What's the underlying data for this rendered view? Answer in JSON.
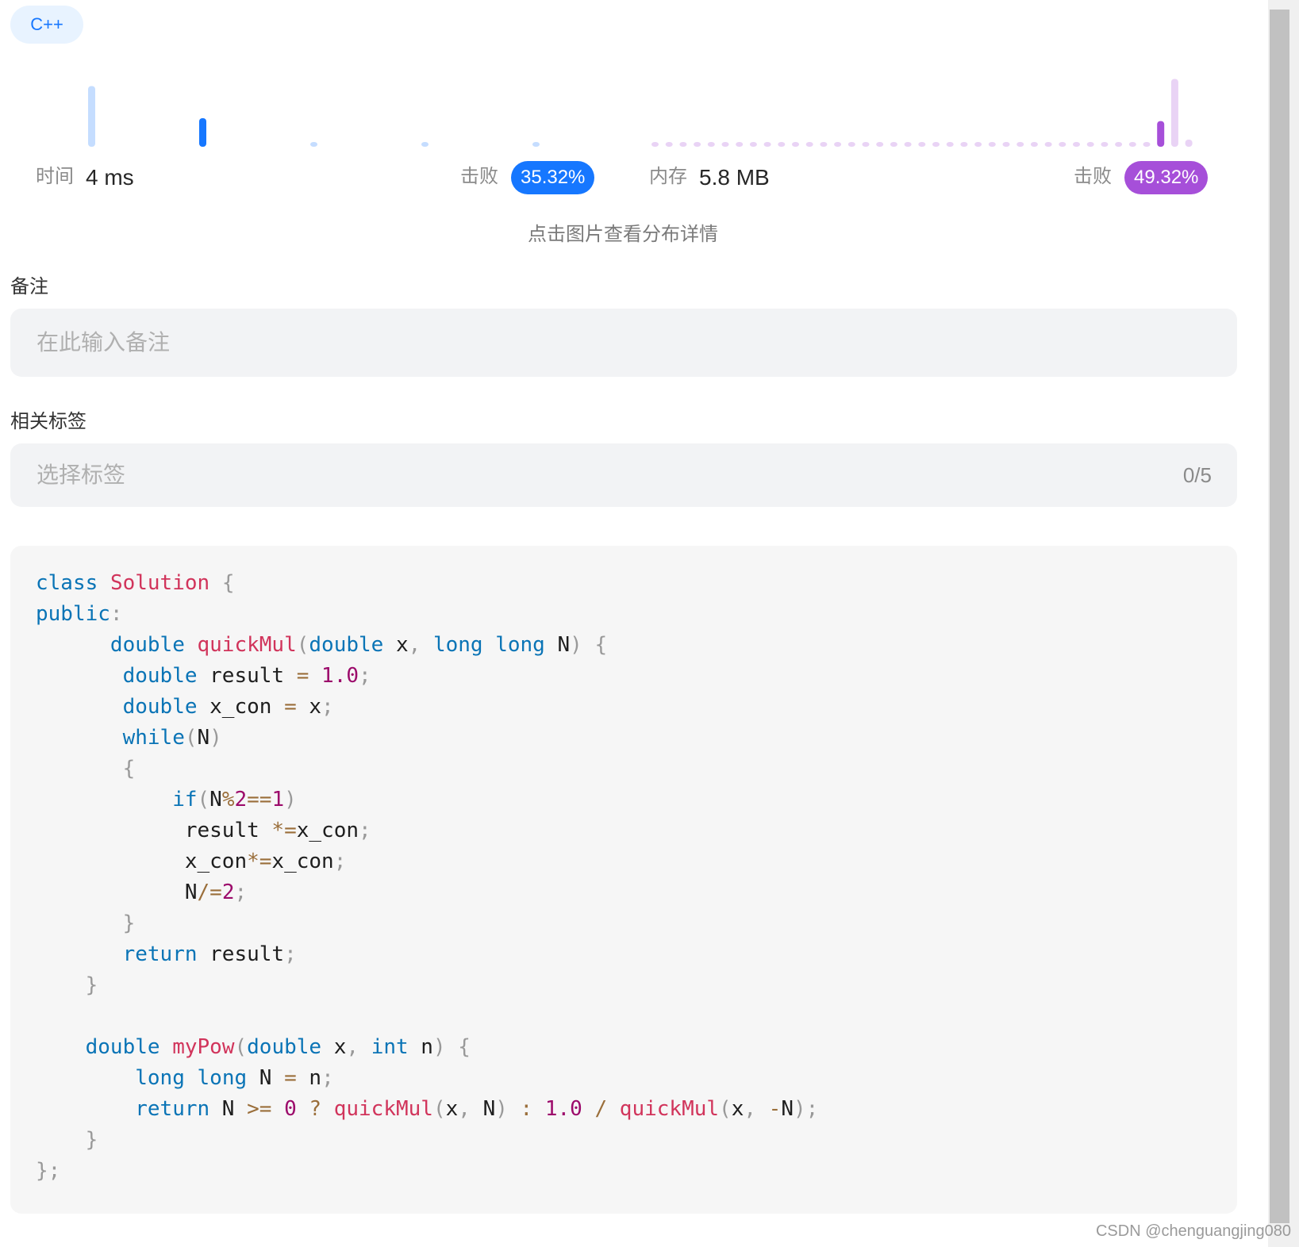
{
  "language_badge": "C++",
  "runtime": {
    "label": "时间",
    "value": "4 ms",
    "beat_label": "击败",
    "beat_percent": "35.32%",
    "color": "#1677ff"
  },
  "memory": {
    "label": "内存",
    "value": "5.8 MB",
    "beat_label": "击败",
    "beat_percent": "49.32%",
    "color": "#a64fd9"
  },
  "chart_hint": "点击图片查看分布详情",
  "notes": {
    "label": "备注",
    "placeholder": "在此输入备注"
  },
  "tags": {
    "label": "相关标签",
    "placeholder": "选择标签",
    "counter": "0/5"
  },
  "chart_data": {
    "type": "bar",
    "title": "",
    "series": [
      {
        "name": "",
        "color": "#1677ff",
        "highlight_index": 1,
        "values": [
          0.85,
          0.4,
          0.04,
          0.04,
          0.04
        ]
      },
      {
        "name": "",
        "color": "#a64fd9",
        "highlight_index": 36,
        "values": [
          0.04,
          0.04,
          0.04,
          0.04,
          0.04,
          0.04,
          0.04,
          0.04,
          0.04,
          0.04,
          0.04,
          0.04,
          0.04,
          0.04,
          0.04,
          0.04,
          0.04,
          0.04,
          0.04,
          0.04,
          0.04,
          0.04,
          0.04,
          0.04,
          0.04,
          0.04,
          0.04,
          0.04,
          0.04,
          0.04,
          0.04,
          0.04,
          0.04,
          0.04,
          0.04,
          0.04,
          0.36,
          0.95,
          0.1
        ]
      }
    ]
  },
  "code": {
    "lines": [
      [
        [
          "kw",
          "class"
        ],
        [
          "id",
          " "
        ],
        [
          "fn",
          "Solution"
        ],
        [
          "id",
          " "
        ],
        [
          "pn",
          "{"
        ]
      ],
      [
        [
          "kw",
          "public"
        ],
        [
          "pn",
          ":"
        ]
      ],
      [
        [
          "id",
          "      "
        ],
        [
          "kw",
          "double"
        ],
        [
          "id",
          " "
        ],
        [
          "fn",
          "quickMul"
        ],
        [
          "pn",
          "("
        ],
        [
          "kw",
          "double"
        ],
        [
          "id",
          " x"
        ],
        [
          "pn",
          ","
        ],
        [
          "id",
          " "
        ],
        [
          "kw",
          "long"
        ],
        [
          "id",
          " "
        ],
        [
          "kw",
          "long"
        ],
        [
          "id",
          " N"
        ],
        [
          "pn",
          ")"
        ],
        [
          "id",
          " "
        ],
        [
          "pn",
          "{"
        ]
      ],
      [
        [
          "id",
          "       "
        ],
        [
          "kw",
          "double"
        ],
        [
          "id",
          " result "
        ],
        [
          "op",
          "="
        ],
        [
          "id",
          " "
        ],
        [
          "num",
          "1.0"
        ],
        [
          "pn",
          ";"
        ]
      ],
      [
        [
          "id",
          "       "
        ],
        [
          "kw",
          "double"
        ],
        [
          "id",
          " x_con "
        ],
        [
          "op",
          "="
        ],
        [
          "id",
          " x"
        ],
        [
          "pn",
          ";"
        ]
      ],
      [
        [
          "id",
          "       "
        ],
        [
          "kw",
          "while"
        ],
        [
          "pn",
          "("
        ],
        [
          "id",
          "N"
        ],
        [
          "pn",
          ")"
        ]
      ],
      [
        [
          "id",
          "       "
        ],
        [
          "pn",
          "{"
        ]
      ],
      [
        [
          "id",
          "           "
        ],
        [
          "kw",
          "if"
        ],
        [
          "pn",
          "("
        ],
        [
          "id",
          "N"
        ],
        [
          "op",
          "%"
        ],
        [
          "num",
          "2"
        ],
        [
          "op",
          "=="
        ],
        [
          "num",
          "1"
        ],
        [
          "pn",
          ")"
        ]
      ],
      [
        [
          "id",
          "            result "
        ],
        [
          "op",
          "*="
        ],
        [
          "id",
          "x_con"
        ],
        [
          "pn",
          ";"
        ]
      ],
      [
        [
          "id",
          "            x_con"
        ],
        [
          "op",
          "*="
        ],
        [
          "id",
          "x_con"
        ],
        [
          "pn",
          ";"
        ]
      ],
      [
        [
          "id",
          "            N"
        ],
        [
          "op",
          "/="
        ],
        [
          "num",
          "2"
        ],
        [
          "pn",
          ";"
        ]
      ],
      [
        [
          "id",
          "       "
        ],
        [
          "pn",
          "}"
        ]
      ],
      [
        [
          "id",
          "       "
        ],
        [
          "kw",
          "return"
        ],
        [
          "id",
          " result"
        ],
        [
          "pn",
          ";"
        ]
      ],
      [
        [
          "id",
          "    "
        ],
        [
          "pn",
          "}"
        ]
      ],
      [
        [
          "id",
          ""
        ]
      ],
      [
        [
          "id",
          "    "
        ],
        [
          "kw",
          "double"
        ],
        [
          "id",
          " "
        ],
        [
          "fn",
          "myPow"
        ],
        [
          "pn",
          "("
        ],
        [
          "kw",
          "double"
        ],
        [
          "id",
          " x"
        ],
        [
          "pn",
          ","
        ],
        [
          "id",
          " "
        ],
        [
          "kw",
          "int"
        ],
        [
          "id",
          " n"
        ],
        [
          "pn",
          ")"
        ],
        [
          "id",
          " "
        ],
        [
          "pn",
          "{"
        ]
      ],
      [
        [
          "id",
          "        "
        ],
        [
          "kw",
          "long"
        ],
        [
          "id",
          " "
        ],
        [
          "kw",
          "long"
        ],
        [
          "id",
          " N "
        ],
        [
          "op",
          "="
        ],
        [
          "id",
          " n"
        ],
        [
          "pn",
          ";"
        ]
      ],
      [
        [
          "id",
          "        "
        ],
        [
          "kw",
          "return"
        ],
        [
          "id",
          " N "
        ],
        [
          "op",
          ">="
        ],
        [
          "id",
          " "
        ],
        [
          "num",
          "0"
        ],
        [
          "id",
          " "
        ],
        [
          "op",
          "?"
        ],
        [
          "id",
          " "
        ],
        [
          "fn",
          "quickMul"
        ],
        [
          "pn",
          "("
        ],
        [
          "id",
          "x"
        ],
        [
          "pn",
          ","
        ],
        [
          "id",
          " N"
        ],
        [
          "pn",
          ")"
        ],
        [
          "id",
          " "
        ],
        [
          "op",
          ":"
        ],
        [
          "id",
          " "
        ],
        [
          "num",
          "1.0"
        ],
        [
          "id",
          " "
        ],
        [
          "op",
          "/"
        ],
        [
          "id",
          " "
        ],
        [
          "fn",
          "quickMul"
        ],
        [
          "pn",
          "("
        ],
        [
          "id",
          "x"
        ],
        [
          "pn",
          ","
        ],
        [
          "id",
          " "
        ],
        [
          "op",
          "-"
        ],
        [
          "id",
          "N"
        ],
        [
          "pn",
          ")"
        ],
        [
          "pn",
          ";"
        ]
      ],
      [
        [
          "id",
          "    "
        ],
        [
          "pn",
          "}"
        ]
      ],
      [
        [
          "pn",
          "};"
        ]
      ]
    ]
  },
  "watermark": "CSDN @chenguangjing080"
}
